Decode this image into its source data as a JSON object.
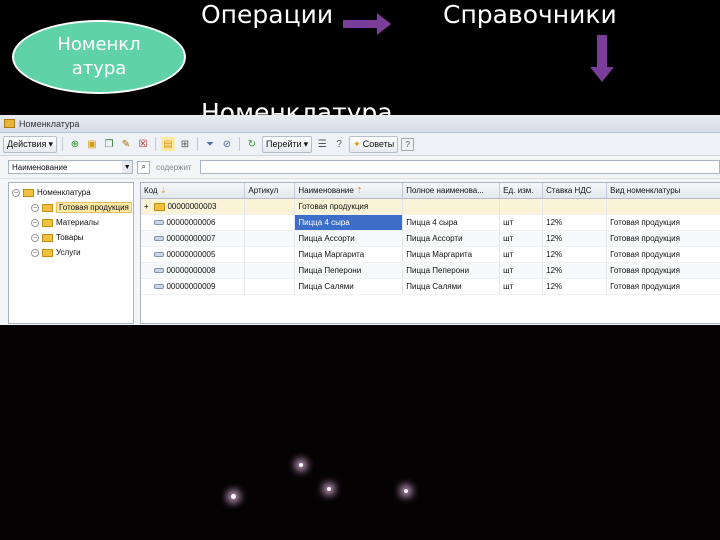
{
  "header": {
    "operations": "Операции",
    "directories": "Справочники",
    "nomenclature": "Номенклатура",
    "badge": "Номенкл атура"
  },
  "colors": {
    "arrow": "#7a3d9a",
    "badge": "#5fd3a7",
    "selection": "#3d6ec7"
  },
  "window": {
    "title": "Номенклатура",
    "toolbar": {
      "actions_label": "Действия",
      "goto_label": "Перейти",
      "tips_label": "Советы",
      "icons": [
        "add-icon",
        "add-group-icon",
        "copy-icon",
        "edit-icon",
        "delete-icon",
        "hierarchy-icon",
        "tree-icon",
        "filter-icon",
        "filter-off-icon",
        "refresh-icon",
        "list-icon",
        "help-icon"
      ]
    },
    "search": {
      "field_value": "Наименование",
      "condition_label": "содержит",
      "query": ""
    },
    "tree": {
      "root": "Номенклатура",
      "items": [
        "Готовая продукция",
        "Материалы",
        "Товары",
        "Услуги"
      ]
    },
    "grid": {
      "columns": [
        "Код",
        "Артикул",
        "Наименование",
        "Полное наименова...",
        "Ед. изм.",
        "Ставка НДС",
        "Вид номенклатуры"
      ],
      "group_row": {
        "code": "00000000003",
        "name": "Готовая продукция"
      },
      "rows": [
        {
          "code": "00000000006",
          "article": "",
          "name": "Пицца 4 сыра",
          "full_name": "Пицца 4 сыра",
          "unit": "шт",
          "vat": "12%",
          "kind": "Готовая продукция"
        },
        {
          "code": "00000000007",
          "article": "",
          "name": "Пицца Ассорти",
          "full_name": "Пицца Ассорти",
          "unit": "шт",
          "vat": "12%",
          "kind": "Готовая продукция"
        },
        {
          "code": "00000000005",
          "article": "",
          "name": "Пицца Маргарита",
          "full_name": "Пицца Маргарита",
          "unit": "шт",
          "vat": "12%",
          "kind": "Готовая продукция"
        },
        {
          "code": "00000000008",
          "article": "",
          "name": "Пицца Пеперони",
          "full_name": "Пицца Пеперони",
          "unit": "шт",
          "vat": "12%",
          "kind": "Готовая продукция"
        },
        {
          "code": "00000000009",
          "article": "",
          "name": "Пицца Салями",
          "full_name": "Пицца Салями",
          "unit": "шт",
          "vat": "12%",
          "kind": "Готовая продукция"
        }
      ]
    }
  }
}
